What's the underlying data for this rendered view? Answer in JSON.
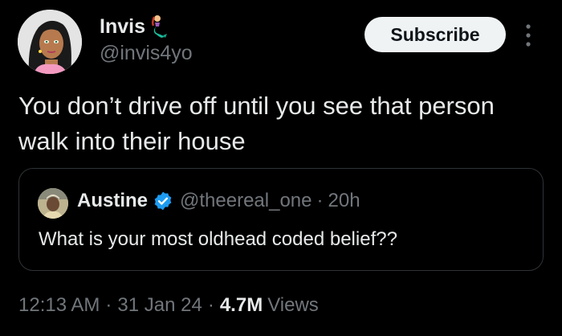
{
  "author": {
    "display_name": "Invis",
    "badge_icon": "mermaid-icon",
    "handle": "@invis4yo",
    "avatar_icon": "cartoon-avatar"
  },
  "actions": {
    "subscribe_label": "Subscribe",
    "more_icon": "more-vertical-icon"
  },
  "tweet": {
    "text": "You don’t drive off until you see that person walk into their house"
  },
  "quoted": {
    "display_name": "Austine",
    "verified_icon": "verified-badge-icon",
    "verified_color": "#1d9bf0",
    "handle": "@theereal_one",
    "separator": "·",
    "time": "20h",
    "text": "What is your most oldhead coded belief??"
  },
  "meta": {
    "time": "12:13 AM",
    "separator": "·",
    "date": "31 Jan 24",
    "views_count": "4.7M",
    "views_label": "Views"
  },
  "colors": {
    "background": "#000000",
    "primary_text": "#e7e9ea",
    "secondary_text": "#71767b",
    "border": "#2f3336",
    "button_bg": "#eff3f4"
  }
}
